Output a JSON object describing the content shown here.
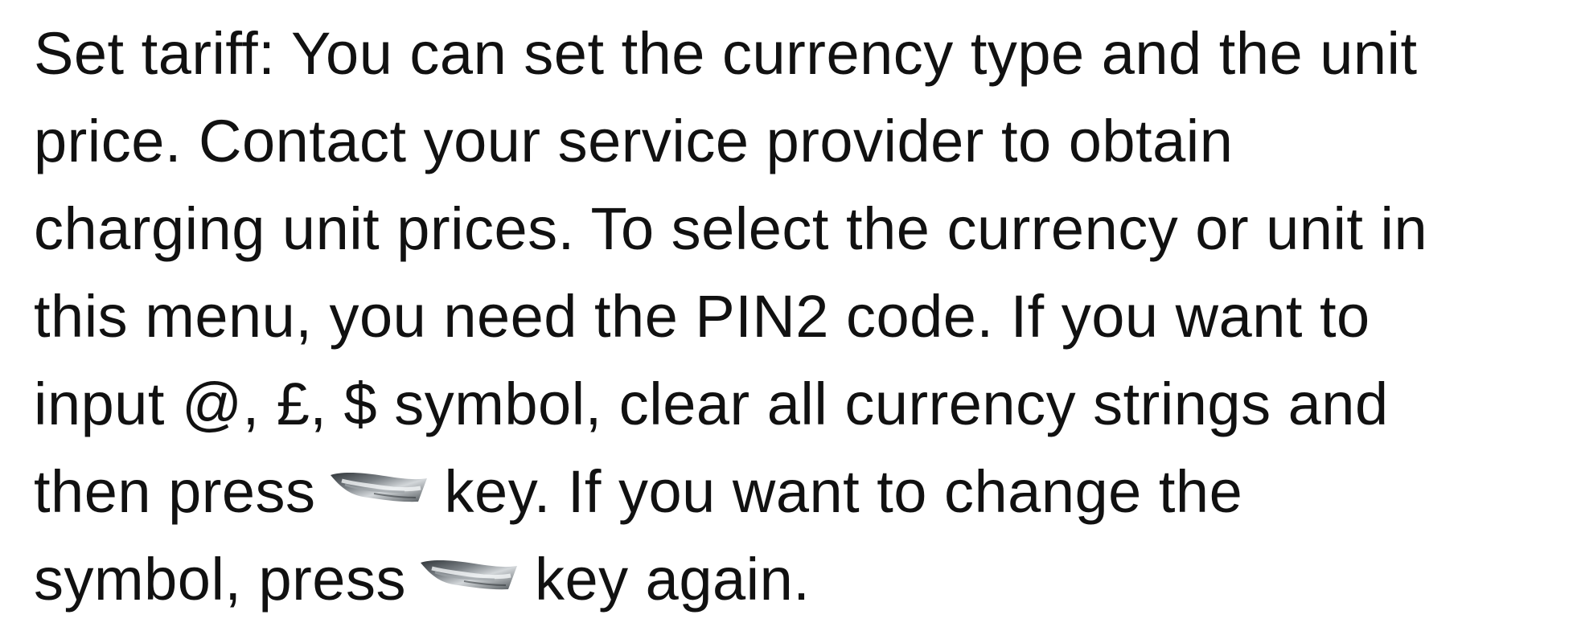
{
  "document": {
    "lines": [
      "Set tariff: You can set the currency type and the unit",
      "price. Contact your service provider to obtain",
      "charging unit prices. To select the currency or unit in",
      "this menu, you need the PIN2 code. If you want to",
      "input @, £, $ symbol, clear all currency strings and"
    ],
    "line6_before": "then press",
    "line6_after": "key. If you want to change the",
    "line7_before": "symbol, press",
    "line7_after": "key again."
  },
  "icons": {
    "soft_key": "soft-key-icon"
  },
  "colors": {
    "text": "#111111",
    "key_body": "#5f6468",
    "key_highlight": "#cfd3d6"
  }
}
